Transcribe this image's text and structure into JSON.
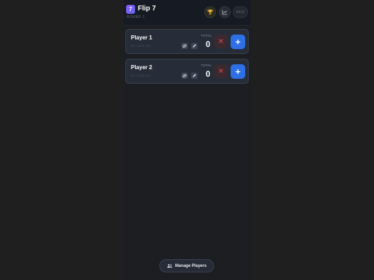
{
  "header": {
    "logo_text": "7",
    "title": "Flip 7",
    "round_label": "ROUND 1",
    "new_label": "NEW",
    "icons": {
      "leaderboard": "trophy-icon",
      "stats": "chart-icon"
    }
  },
  "players": [
    {
      "name": "Player 1",
      "subtitle": "No cards yet",
      "total_label": "TOTAL",
      "total": "0",
      "bust_symbol": "✕",
      "add_symbol": "+"
    },
    {
      "name": "Player 2",
      "subtitle": "No cards yet",
      "total_label": "TOTAL",
      "total": "0",
      "bust_symbol": "✕",
      "add_symbol": "+"
    }
  ],
  "footer": {
    "manage_label": "Manage Players",
    "icon": "users-icon"
  },
  "colors": {
    "accent": "#2f6fe6",
    "bust": "#ef4444",
    "logo": "#7c5cf0"
  }
}
